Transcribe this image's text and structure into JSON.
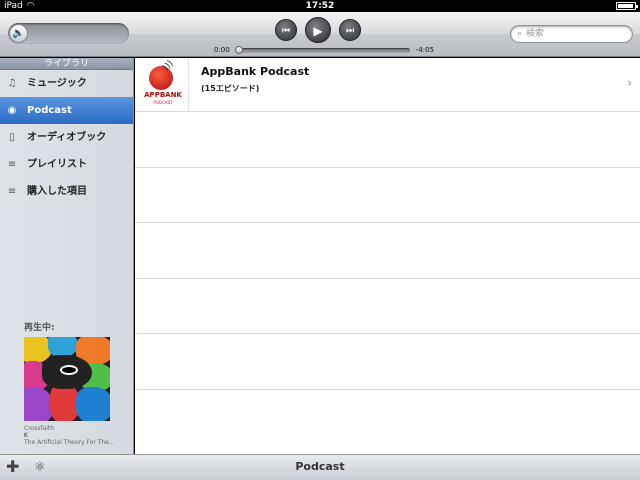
{
  "status_bar": {
    "device": "iPad",
    "time": "17:52"
  },
  "toolbar": {
    "time_elapsed": "0:00",
    "time_remaining": "-4:05",
    "search_placeholder": "検索",
    "progress": 0.0
  },
  "sidebar": {
    "header": "ライブラリ",
    "items": [
      {
        "label": "ミュージック",
        "icon": "music-note-icon",
        "active": false
      },
      {
        "label": "Podcast",
        "icon": "podcast-icon",
        "active": true
      },
      {
        "label": "オーディオブック",
        "icon": "audiobook-icon",
        "active": false
      },
      {
        "label": "プレイリスト",
        "icon": "playlist-icon",
        "active": false
      },
      {
        "label": "購入した項目",
        "icon": "playlist-icon",
        "active": false
      }
    ],
    "now_playing": {
      "label": "再生中:",
      "artist": "Crossfaith",
      "track": "K",
      "album": "The Artificial Theory For The..."
    }
  },
  "main": {
    "podcasts": [
      {
        "title": "AppBank Podcast",
        "episodes": "(15エピソード)",
        "logo_text": "APPBANK",
        "logo_sub": "PODCAST"
      }
    ]
  },
  "bottom_bar": {
    "title": "Podcast"
  },
  "colors": {
    "accent": "#2b6bc4",
    "brand_red": "#b01010"
  }
}
